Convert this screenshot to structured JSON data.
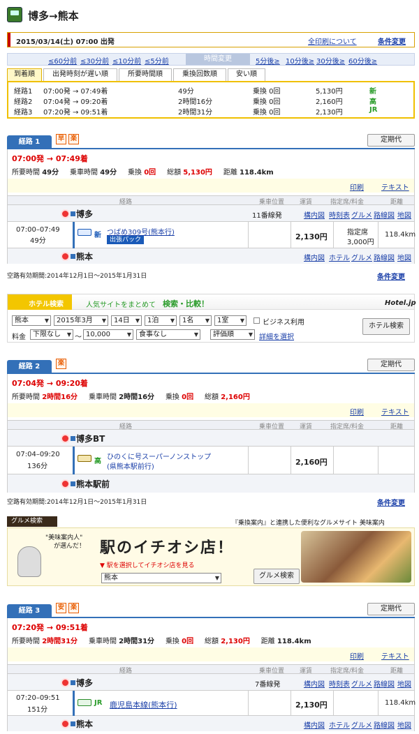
{
  "header": {
    "title": "博多→熊本"
  },
  "datebar": {
    "datetime": "2015/03/14(土) 07:00 出発",
    "print_all": "全印刷について",
    "cond": "条件変更"
  },
  "timebar": {
    "m60": "≤60分前",
    "m30": "≤30分前",
    "m10": "≤10分前",
    "m5": "≤5分前",
    "change": "時間変更",
    "p5": "5分後≥",
    "p10": "10分後≥",
    "p30": "30分後≥",
    "p60": "60分後≥"
  },
  "tabs": [
    "到着順",
    "出発時刻が遅い順",
    "所要時間順",
    "乗換回数順",
    "安い順"
  ],
  "summary": [
    {
      "name": "経路1",
      "time": "07:00発 → 07:49着",
      "dur": "49分",
      "tr": "乗換 0回",
      "fare": "5,130円",
      "tag": "新"
    },
    {
      "name": "経路2",
      "time": "07:04発 → 09:20着",
      "dur": "2時間16分",
      "tr": "乗換 0回",
      "fare": "2,160円",
      "tag": "高"
    },
    {
      "name": "経路3",
      "time": "07:20発 → 09:51着",
      "dur": "2時間31分",
      "tr": "乗換 0回",
      "fare": "2,130円",
      "tag": "JR"
    }
  ],
  "common": {
    "teiki": "定期代",
    "print": "印刷",
    "text": "テキスト",
    "col_route": "経路",
    "col_pos": "乗車位置",
    "col_fare": "運賃",
    "col_seat": "指定席/料金",
    "col_dist": "距離",
    "link_kounai": "構内図",
    "link_jikoku": "時刻表",
    "link_gourmet": "グルメ",
    "link_rosen": "路線図",
    "link_map": "地図",
    "link_hotel": "ホテル",
    "valid": "空路有効期間:2014年12月1日〜2015年1月31日",
    "cond": "条件変更",
    "lbl_req": "所要時間",
    "lbl_ride": "乗車時間",
    "lbl_tr": "乗換",
    "lbl_total": "総額",
    "lbl_dist": "距離"
  },
  "r1": {
    "tab": "経路 1",
    "b1": "早",
    "b2": "楽",
    "dep": "07:00発",
    "arr": "→ 07:49着",
    "req": "49分",
    "ride": "49分",
    "tr": "0回",
    "total": "5,130円",
    "dist": "118.4km",
    "st1": "博多",
    "st1_track": "11番線発",
    "seg_time": "07:00–07:49",
    "seg_dur": "49分",
    "train": "つばめ309号(熊本行)",
    "pack": "出張パック",
    "fare": "2,130円",
    "seat": "指定席",
    "seat_fee": "3,000円",
    "km": "118.4km",
    "st2": "熊本"
  },
  "hotel": {
    "title": "ホテル検索",
    "catch": "人気サイトをまとめて",
    "catch2": "検索・比較！",
    "brand": "Hotel.jp",
    "pref": "熊本",
    "month": "2015年3月",
    "day": "14日",
    "nights": "1泊",
    "people": "1名",
    "rooms": "1室",
    "business": "ビジネス利用",
    "fee_label": "料金",
    "min": "下限なし",
    "tilde": "〜",
    "max": "10,000",
    "meal": "食事なし",
    "rating": "評価順",
    "detail": "詳細を選択",
    "search": "ホテル検索"
  },
  "r2": {
    "tab": "経路 2",
    "b1": "楽",
    "dep": "07:04発",
    "arr": "→ 09:20着",
    "req": "2時間16分",
    "ride": "2時間16分",
    "tr": "0回",
    "total": "2,160円",
    "st1": "博多BT",
    "seg_time": "07:04–09:20",
    "seg_dur": "136分",
    "bus": "ひのくに号スーパーノンストップ",
    "bus2": "(県熊本駅前行)",
    "fare": "2,160円",
    "st2": "熊本駅前",
    "bus_tag": "高"
  },
  "gourmet": {
    "label": "グルメ検索",
    "tagline": "『乗換案内』と連携した便利なグルメサイト 美味案内",
    "bubble1": "\"美味案内人\"",
    "bubble2": "が選んだ！",
    "big": "駅のイチオシ店！",
    "sub": "▼ 駅を選択してイチオシ店を見る",
    "station": "熊本",
    "button": "グルメ検索"
  },
  "r3": {
    "tab": "経路 3",
    "b1": "安",
    "b2": "楽",
    "dep": "07:20発",
    "arr": "→ 09:51着",
    "req": "2時間31分",
    "ride": "2時間31分",
    "tr": "0回",
    "total": "2,130円",
    "dist": "118.4km",
    "st1": "博多",
    "st1_track": "7番線発",
    "seg_time": "07:20–09:51",
    "seg_dur": "151分",
    "train": "鹿児島本線(熊本行)",
    "tag": "JR",
    "fare": "2,130円",
    "km": "118.4km",
    "st2": "熊本"
  },
  "colors": {
    "blue": "#3370b8",
    "red": "#dd0000",
    "yellow": "#f0c000"
  }
}
